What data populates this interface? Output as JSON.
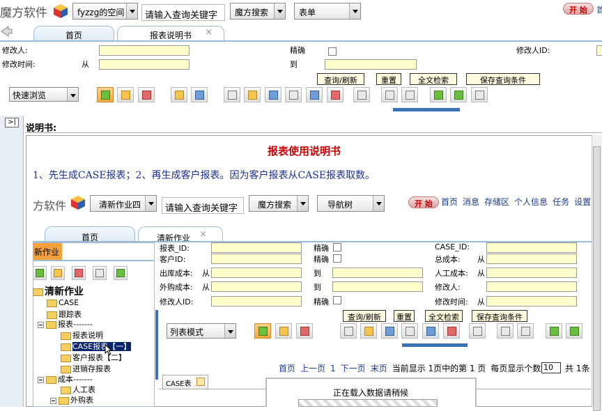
{
  "outer": {
    "brand": "魔方软件",
    "space_dropdown": "fyzzg的空间",
    "search_placeholder": "请输入查询关键字",
    "search_btn": "魔方搜索",
    "form_dropdown": "表单",
    "start_btn": "开 始",
    "top_right_link": "首",
    "tabs": [
      "首页",
      "报表说明书"
    ],
    "tab_close": "×",
    "filter": {
      "modifier_label": "修改人:",
      "exact_label": "精确",
      "modifier_id_label": "修改人ID:",
      "modified_time_label": "修改时间:",
      "from_label": "从",
      "to_label": "到"
    },
    "buttons": [
      "查询/刷新",
      "重置",
      "全文检索",
      "保存查询条件"
    ],
    "view_mode": "快速浏览",
    "collapse_icon": "⊠",
    "desc_title": "说明书:"
  },
  "doc": {
    "heading": "报表使用说明书",
    "line1": "1、先生成CASE报表；2、再生成客户报表。因为客户报表从CASE报表取数。"
  },
  "inner": {
    "brand": "方软件",
    "work_dropdown": "清新作业四",
    "search_placeholder": "请输入查询关键字",
    "search_btn": "魔方搜索",
    "nav_dropdown": "导航树",
    "start_btn": "开 始",
    "nav_links": [
      "首页",
      "消息",
      "存储区",
      "个人信息",
      "任务",
      "设置"
    ],
    "tabs": [
      "首页",
      "清新作业"
    ],
    "tab_close": "×",
    "side_tab": "新作业",
    "tree": {
      "root": "清新作业",
      "items": [
        "CASE",
        "跟踪表",
        "报表-------",
        "报表说明",
        "CASE报表【一】",
        "客户报表【二】",
        "进销存报表",
        "成本-------",
        "人工表",
        "外购表"
      ]
    },
    "fields": {
      "report_id": "报表_ID:",
      "exact1": "精确",
      "case_id": "CASE_ID:",
      "customer_id": "客户ID:",
      "exact2": "精确",
      "total_cost": "总成本:",
      "from1": "从",
      "out_cost": "出库成本:",
      "from2": "从",
      "to1": "到",
      "labor_cost": "人工成本:",
      "from3": "从",
      "outsource_cost": "外购成本:",
      "from4": "从",
      "to2": "到",
      "modifier": "修改人:",
      "modifier_id": "修改人ID:",
      "exact3": "精确",
      "modified_time": "修改时间:",
      "from5": "从"
    },
    "buttons": [
      "查询/刷新",
      "重置",
      "全文检索",
      "保存查询条件"
    ],
    "view_mode": "列表模式",
    "pager": {
      "first": "首页",
      "prev": "上一页",
      "page_num": "1",
      "next": "下一页",
      "last": "末页",
      "status": "当前显示 1页中的第 1 页",
      "per_page_label": "每页显示个数:",
      "per_page_value": "10",
      "total": "共 1条"
    },
    "case_tab": "CASE表",
    "loading": "正在载入数据请稍候"
  }
}
